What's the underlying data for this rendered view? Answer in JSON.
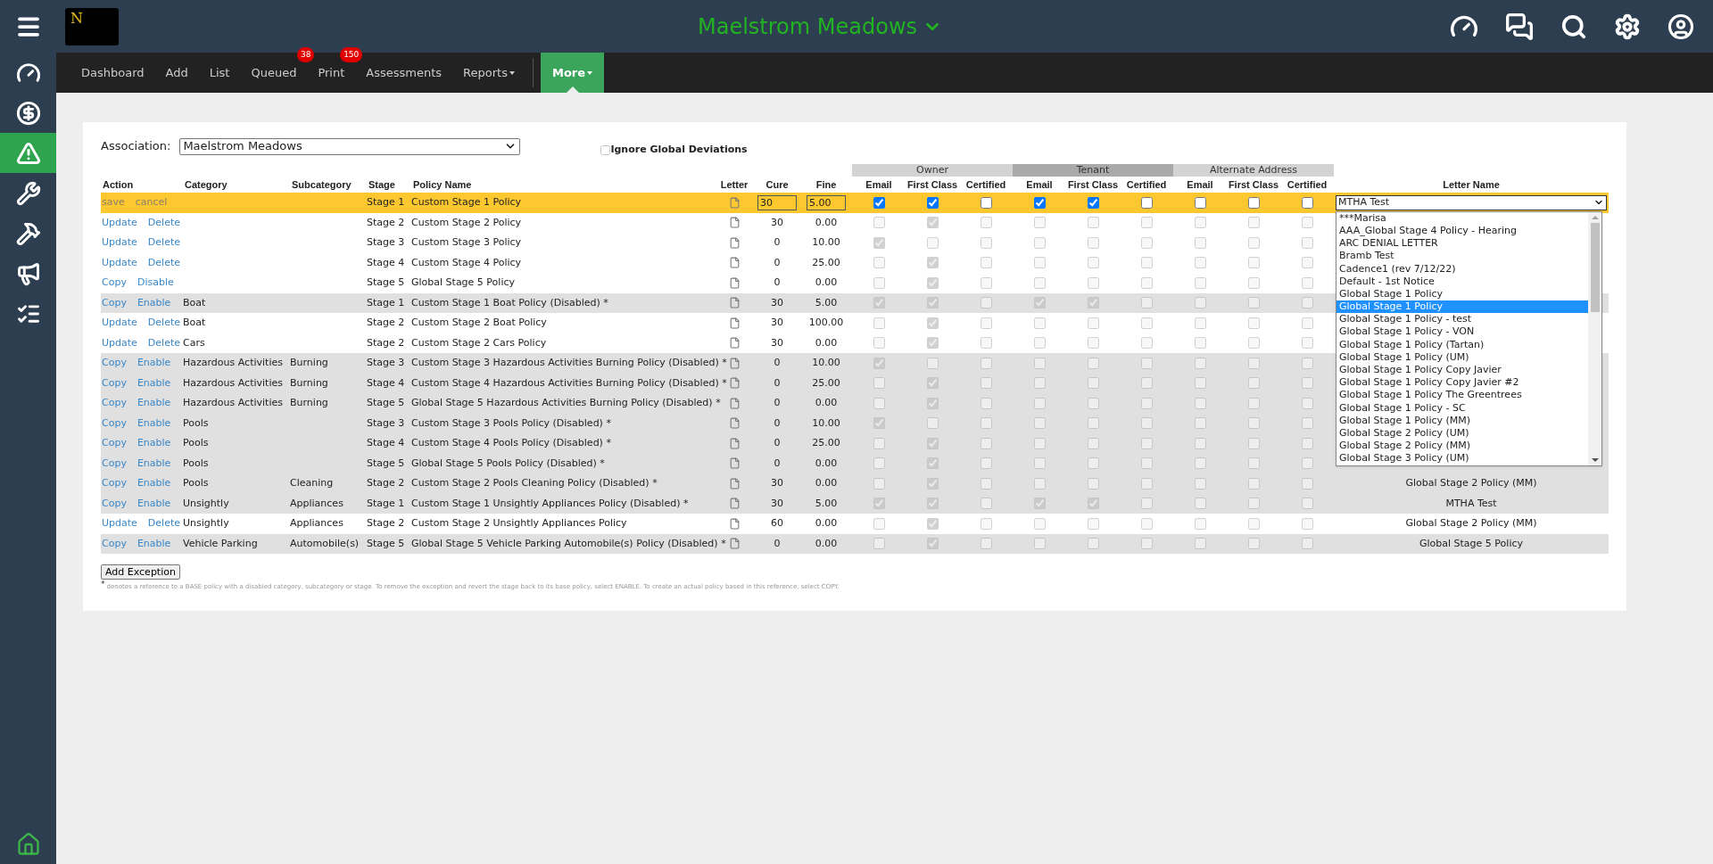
{
  "header": {
    "logo_letter": "N",
    "title": "Maelstrom Meadows"
  },
  "sidebar": {
    "items": [
      {
        "selected": false
      },
      {
        "selected": false
      },
      {
        "selected": true
      },
      {
        "selected": false
      },
      {
        "selected": false
      },
      {
        "selected": false
      },
      {
        "selected": false
      }
    ]
  },
  "nav": {
    "items": [
      {
        "label": "Dashboard",
        "selected": false
      },
      {
        "label": "Add",
        "selected": false
      },
      {
        "label": "List",
        "selected": false
      },
      {
        "label": "Queued",
        "badge": "38",
        "selected": false
      },
      {
        "label": "Print",
        "badge": "150",
        "selected": false
      },
      {
        "label": "Assessments",
        "selected": false
      },
      {
        "label": "Reports",
        "dropdown": true,
        "selected": false
      }
    ],
    "more": {
      "label": "More",
      "selected": true
    }
  },
  "association": {
    "label": "Association:",
    "value": "Maelstrom Meadows"
  },
  "ignore_global": {
    "label": "Ignore Global Deviations",
    "checked": false
  },
  "table": {
    "columns": [
      "Action",
      "Category",
      "Subcategory",
      "Stage",
      "Policy Name",
      "Letter",
      "Cure",
      "Fine"
    ],
    "groups": [
      {
        "name": "Owner",
        "kind": "light",
        "columns": [
          "Email",
          "First Class",
          "Certified"
        ]
      },
      {
        "name": "Tenant",
        "kind": "dark",
        "columns": [
          "Email",
          "First Class",
          "Certified"
        ]
      },
      {
        "name": "Alternate Address",
        "kind": "light",
        "columns": [
          "Email",
          "First Class",
          "Certified"
        ]
      }
    ],
    "letter_name_column": "Letter Name",
    "rows": [
      {
        "kind": "edit",
        "actions": [
          "save",
          "cancel"
        ],
        "category": "",
        "subcategory": "",
        "stage": "Stage 1",
        "policy": "Custom Stage 1 Policy",
        "cure": "30",
        "fine": "5.00",
        "delivery": [
          true,
          true,
          false,
          true,
          true,
          false,
          false,
          false,
          false
        ],
        "letter_select": {
          "value": "MTHA Test",
          "expanded": true,
          "options": [
            {
              "label": "***Marisa",
              "selected": false
            },
            {
              "label": "AAA_Global Stage 4 Policy - Hearing",
              "selected": false
            },
            {
              "label": "ARC DENIAL LETTER",
              "selected": false
            },
            {
              "label": "Bramb Test",
              "selected": false
            },
            {
              "label": "Cadence1 (rev 7/12/22)",
              "selected": false
            },
            {
              "label": "Default - 1st Notice",
              "selected": false
            },
            {
              "label": "Global Stage 1 Policy",
              "selected": false
            },
            {
              "label": "Global Stage 1 Policy",
              "selected": true
            },
            {
              "label": "Global Stage 1 Policy - test",
              "selected": false
            },
            {
              "label": "Global Stage 1 Policy - VON",
              "selected": false
            },
            {
              "label": "Global Stage 1 Policy (Tartan)",
              "selected": false
            },
            {
              "label": "Global Stage 1 Policy (UM)",
              "selected": false
            },
            {
              "label": "Global Stage 1 Policy Copy Javier",
              "selected": false
            },
            {
              "label": "Global Stage 1 Policy Copy Javier #2",
              "selected": false
            },
            {
              "label": "Global Stage 1 Policy The Greentrees",
              "selected": false
            },
            {
              "label": "Global Stage 1 Policy - SC",
              "selected": false
            },
            {
              "label": "Global Stage 1 Policy (MM)",
              "selected": false
            },
            {
              "label": "Global Stage 2 Policy (UM)",
              "selected": false
            },
            {
              "label": "Global Stage 2 Policy (MM)",
              "selected": false
            },
            {
              "label": "Global Stage 3 Policy (UM)",
              "selected": false
            }
          ]
        }
      },
      {
        "kind": "active",
        "actions": [
          "Update",
          "Delete"
        ],
        "category": "",
        "subcategory": "",
        "stage": "Stage 2",
        "policy": "Custom Stage 2 Policy",
        "cure": "30",
        "fine": "0.00",
        "delivery": [
          false,
          true,
          false,
          false,
          false,
          false,
          false,
          false,
          false
        ]
      },
      {
        "kind": "active",
        "actions": [
          "Update",
          "Delete"
        ],
        "category": "",
        "subcategory": "",
        "stage": "Stage 3",
        "policy": "Custom Stage 3 Policy",
        "cure": "0",
        "fine": "10.00",
        "delivery": [
          true,
          false,
          false,
          false,
          false,
          false,
          false,
          false,
          false
        ]
      },
      {
        "kind": "active",
        "actions": [
          "Update",
          "Delete"
        ],
        "category": "",
        "subcategory": "",
        "stage": "Stage 4",
        "policy": "Custom Stage 4 Policy",
        "cure": "0",
        "fine": "25.00",
        "delivery": [
          false,
          true,
          false,
          false,
          false,
          false,
          false,
          false,
          false
        ]
      },
      {
        "kind": "active",
        "actions": [
          "Copy",
          "Disable"
        ],
        "category": "",
        "subcategory": "",
        "stage": "Stage 5",
        "policy": "Global Stage 5 Policy",
        "cure": "0",
        "fine": "0.00",
        "delivery": [
          false,
          true,
          false,
          false,
          false,
          false,
          false,
          false,
          false
        ]
      },
      {
        "kind": "disabled",
        "actions": [
          "Copy",
          "Enable"
        ],
        "category": "Boat",
        "subcategory": "",
        "stage": "Stage 1",
        "policy": "Custom Stage 1 Boat Policy (Disabled) *",
        "cure": "30",
        "fine": "5.00",
        "delivery": [
          true,
          true,
          false,
          true,
          true,
          false,
          false,
          false,
          false
        ]
      },
      {
        "kind": "active",
        "actions": [
          "Update",
          "Delete"
        ],
        "category": "Boat",
        "subcategory": "",
        "stage": "Stage 2",
        "policy": "Custom Stage 2 Boat Policy",
        "cure": "30",
        "fine": "100.00",
        "delivery": [
          false,
          true,
          false,
          false,
          false,
          false,
          false,
          false,
          false
        ]
      },
      {
        "kind": "active",
        "actions": [
          "Update",
          "Delete"
        ],
        "category": "Cars",
        "subcategory": "",
        "stage": "Stage 2",
        "policy": "Custom Stage 2 Cars Policy",
        "cure": "30",
        "fine": "0.00",
        "delivery": [
          false,
          true,
          false,
          false,
          false,
          false,
          false,
          false,
          false
        ]
      },
      {
        "kind": "disabled",
        "actions": [
          "Copy",
          "Enable"
        ],
        "category": "Hazardous Activities",
        "subcategory": "Burning",
        "stage": "Stage 3",
        "policy": "Custom Stage 3 Hazardous Activities Burning Policy (Disabled) *",
        "cure": "0",
        "fine": "10.00",
        "delivery": [
          true,
          false,
          false,
          false,
          false,
          false,
          false,
          false,
          false
        ]
      },
      {
        "kind": "disabled",
        "actions": [
          "Copy",
          "Enable"
        ],
        "category": "Hazardous Activities",
        "subcategory": "Burning",
        "stage": "Stage 4",
        "policy": "Custom Stage 4 Hazardous Activities Burning Policy (Disabled) *",
        "cure": "0",
        "fine": "25.00",
        "delivery": [
          false,
          true,
          false,
          false,
          false,
          false,
          false,
          false,
          false
        ]
      },
      {
        "kind": "disabled",
        "actions": [
          "Copy",
          "Enable"
        ],
        "category": "Hazardous Activities",
        "subcategory": "Burning",
        "stage": "Stage 5",
        "policy": "Global Stage 5 Hazardous Activities Burning Policy (Disabled) *",
        "cure": "0",
        "fine": "0.00",
        "delivery": [
          false,
          true,
          false,
          false,
          false,
          false,
          false,
          false,
          false
        ]
      },
      {
        "kind": "disabled",
        "actions": [
          "Copy",
          "Enable"
        ],
        "category": "Pools",
        "subcategory": "",
        "stage": "Stage 3",
        "policy": "Custom Stage 3 Pools Policy (Disabled) *",
        "cure": "0",
        "fine": "10.00",
        "delivery": [
          true,
          false,
          false,
          false,
          false,
          false,
          false,
          false,
          false
        ]
      },
      {
        "kind": "disabled",
        "actions": [
          "Copy",
          "Enable"
        ],
        "category": "Pools",
        "subcategory": "",
        "stage": "Stage 4",
        "policy": "Custom Stage 4 Pools Policy (Disabled) *",
        "cure": "0",
        "fine": "25.00",
        "delivery": [
          false,
          true,
          false,
          false,
          false,
          false,
          false,
          false,
          false
        ]
      },
      {
        "kind": "disabled",
        "actions": [
          "Copy",
          "Enable"
        ],
        "category": "Pools",
        "subcategory": "",
        "stage": "Stage 5",
        "policy": "Global Stage 5 Pools Policy (Disabled) *",
        "cure": "0",
        "fine": "0.00",
        "delivery": [
          false,
          true,
          false,
          false,
          false,
          false,
          false,
          false,
          false
        ]
      },
      {
        "kind": "disabled",
        "actions": [
          "Copy",
          "Enable"
        ],
        "category": "Pools",
        "subcategory": "Cleaning",
        "stage": "Stage 2",
        "policy": "Custom Stage 2 Pools Cleaning Policy (Disabled) *",
        "cure": "30",
        "fine": "0.00",
        "delivery": [
          false,
          true,
          false,
          false,
          false,
          false,
          false,
          false,
          false
        ],
        "letter_name": "Global Stage 2 Policy (MM)"
      },
      {
        "kind": "disabled",
        "actions": [
          "Copy",
          "Enable"
        ],
        "category": "Unsightly",
        "subcategory": "Appliances",
        "stage": "Stage 1",
        "policy": "Custom Stage 1 Unsightly Appliances Policy (Disabled) *",
        "cure": "30",
        "fine": "5.00",
        "delivery": [
          true,
          true,
          false,
          true,
          true,
          false,
          false,
          false,
          false
        ],
        "letter_name": "MTHA Test"
      },
      {
        "kind": "active",
        "actions": [
          "Update",
          "Delete"
        ],
        "category": "Unsightly",
        "subcategory": "Appliances",
        "stage": "Stage 2",
        "policy": "Custom Stage 2 Unsightly Appliances Policy",
        "cure": "60",
        "fine": "0.00",
        "delivery": [
          false,
          true,
          false,
          false,
          false,
          false,
          false,
          false,
          false
        ],
        "letter_name": "Global Stage 2 Policy (MM)"
      },
      {
        "kind": "disabled",
        "actions": [
          "Copy",
          "Enable"
        ],
        "category": "Vehicle Parking",
        "subcategory": "Automobile(s)",
        "stage": "Stage 5",
        "policy": "Global Stage 5 Vehicle Parking Automobile(s) Policy (Disabled) *",
        "cure": "0",
        "fine": "0.00",
        "delivery": [
          false,
          true,
          false,
          false,
          false,
          false,
          false,
          false,
          false
        ],
        "letter_name": "Global Stage 5 Policy"
      }
    ]
  },
  "add_button": "Add Exception",
  "footnote_mark": "*",
  "footnote": "denotes a reference to a BASE policy with a disabled category, subcategory or stage. To remove the exception and revert the stage back to its base policy, select ENABLE. To create an actual policy based in this reference, select COPY."
}
